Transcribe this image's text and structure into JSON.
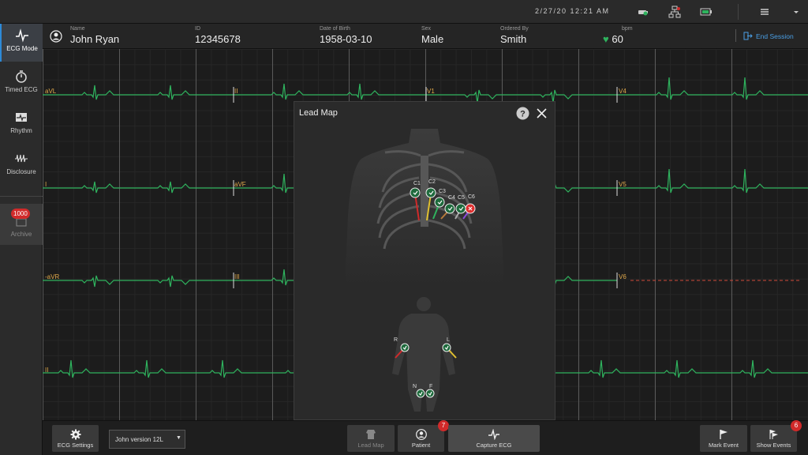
{
  "topbar": {
    "datetime": "2/27/20  12:21  AM",
    "icons": [
      "connection-icon",
      "network-icon",
      "battery-icon",
      "menu-icon",
      "dropdown-icon"
    ]
  },
  "sidebar": {
    "items": [
      {
        "label": "ECG Mode",
        "icon": "ecg-wave-icon",
        "active": true
      },
      {
        "label": "Timed ECG",
        "icon": "stopwatch-icon",
        "active": false
      },
      {
        "label": "Rhythm",
        "icon": "rhythm-icon",
        "active": false
      },
      {
        "label": "Disclosure",
        "icon": "disclosure-icon",
        "active": false
      }
    ],
    "archive": {
      "label": "Archive",
      "badge": "1000",
      "icon": "archive-icon"
    }
  },
  "patient": {
    "name_label": "Name",
    "name": "John Ryan",
    "id_label": "ID",
    "id": "12345678",
    "dob_label": "Date of Birth",
    "dob": "1958-03-10",
    "sex_label": "Sex",
    "sex": "Male",
    "ordered_label": "Ordered By",
    "ordered": "Smith",
    "bpm_label": "bpm",
    "bpm": "60",
    "end_session": "End Session"
  },
  "leads": [
    "aVL",
    "II",
    "V1",
    "V4",
    "I",
    "aVF",
    "V2",
    "V5",
    "-aVR",
    "III",
    "V3",
    "V6",
    "II"
  ],
  "colors": {
    "trace": "#2fb35e",
    "lead_label": "#e0a94a",
    "accent": "#2d8ad8",
    "badge": "#d12a2a",
    "error": "#e03030"
  },
  "modal": {
    "title": "Lead Map",
    "electrodes": [
      "C1",
      "C2",
      "C3",
      "C4",
      "C5",
      "C6",
      "R",
      "L",
      "N",
      "F"
    ]
  },
  "bottombar": {
    "ecg_settings": "ECG Settings",
    "profile_value": "John version 12L",
    "lead_map": "Lead Map",
    "patient": "Patient",
    "patient_badge": "7",
    "capture": "Capture ECG",
    "mark_event": "Mark Event",
    "show_events": "Show Events",
    "events_badge": "6"
  }
}
